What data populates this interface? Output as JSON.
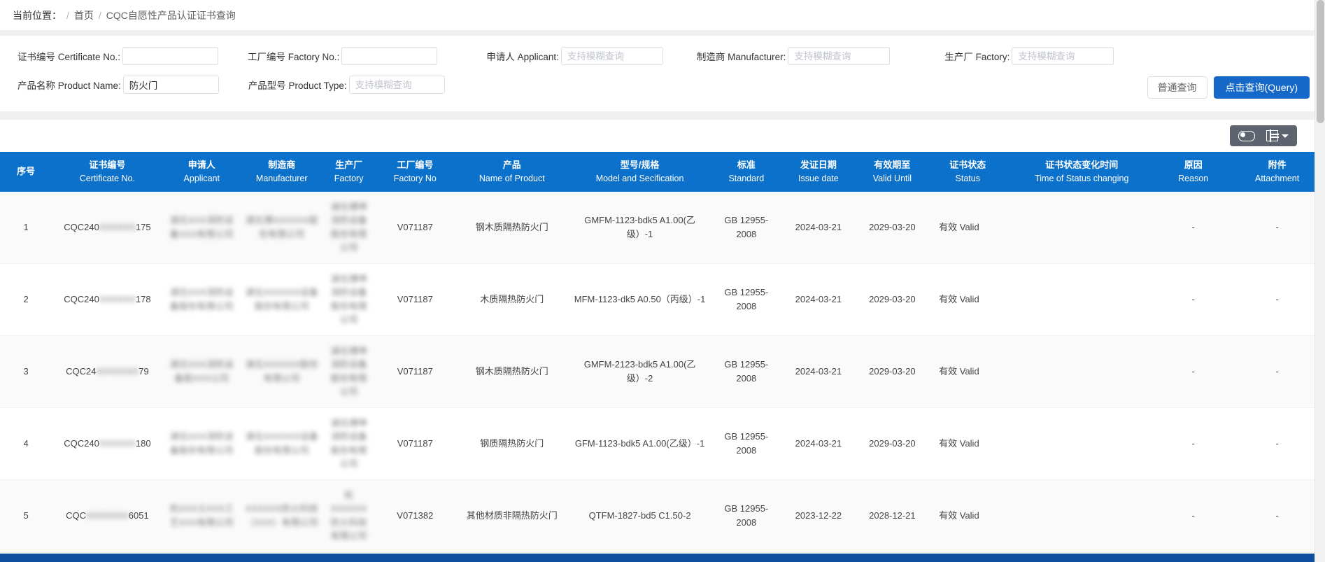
{
  "breadcrumb": {
    "label": "当前位置：",
    "sep": "/",
    "home": "首页",
    "current": "CQC自愿性产品认证证书查询"
  },
  "search": {
    "fields": [
      {
        "label": "证书编号 Certificate No.:",
        "value": "",
        "placeholder": ""
      },
      {
        "label": "工厂编号 Factory No.:",
        "value": "",
        "placeholder": ""
      },
      {
        "label": "申请人 Applicant:",
        "value": "",
        "placeholder": "支持模糊查询"
      },
      {
        "label": "制造商 Manufacturer:",
        "value": "",
        "placeholder": "支持模糊查询"
      },
      {
        "label": "生产厂 Factory:",
        "value": "",
        "placeholder": "支持模糊查询"
      },
      {
        "label": "产品名称 Product Name:",
        "value": "防火门",
        "placeholder": ""
      },
      {
        "label": "产品型号 Product Type:",
        "value": "",
        "placeholder": "支持模糊查询"
      }
    ],
    "normal_query_button": "普通查询",
    "query_button": "点击查询(Query)"
  },
  "toolbar": {
    "toggle_icon": "toggle-switch-icon",
    "columns_icon": "table-columns-icon",
    "caret_icon": "chevron-down-icon"
  },
  "table": {
    "columns": [
      {
        "cn": "序号",
        "en": ""
      },
      {
        "cn": "证书编号",
        "en": "Certificate No."
      },
      {
        "cn": "申请人",
        "en": "Applicant"
      },
      {
        "cn": "制造商",
        "en": "Manufacturer"
      },
      {
        "cn": "生产厂",
        "en": "Factory"
      },
      {
        "cn": "工厂编号",
        "en": "Factory No"
      },
      {
        "cn": "产品",
        "en": "Name of Product"
      },
      {
        "cn": "型号/规格",
        "en": "Model and Secification"
      },
      {
        "cn": "标准",
        "en": "Standard"
      },
      {
        "cn": "发证日期",
        "en": "Issue date"
      },
      {
        "cn": "有效期至",
        "en": "Valid Until"
      },
      {
        "cn": "证书状态",
        "en": "Status"
      },
      {
        "cn": "证书状态变化时间",
        "en": "Time of Status changing"
      },
      {
        "cn": "原因",
        "en": "Reason"
      },
      {
        "cn": "附件",
        "en": "Attachment"
      }
    ],
    "rows": [
      {
        "index": "1",
        "certificate_no_prefix": "CQC240",
        "certificate_no_redacted": "XXXXXX",
        "certificate_no_suffix": "175",
        "applicant": "湖北XXX消防设备XXX有限公司",
        "manufacturer": "湖北博XXXXXX股份有限公司",
        "factory": "湖北博坤消防设备股份有限公司",
        "factory_no": "V071187",
        "product": "钢木质隔热防火门",
        "model": "GMFM-1123-bdk5 A1.00(乙级）-1",
        "standard": "GB 12955-2008",
        "issue_date": "2024-03-21",
        "valid_until": "2029-03-20",
        "status": "有效 Valid",
        "status_change_time": "",
        "reason": "-",
        "attachment": "-"
      },
      {
        "index": "2",
        "certificate_no_prefix": "CQC240",
        "certificate_no_redacted": "XXXXXX",
        "certificate_no_suffix": "178",
        "applicant": "湖北XXX消防设备股份有限公司",
        "manufacturer": "湖北XXXXXX设备股份有限公司",
        "factory": "湖北博坤消防设备股份有限公司",
        "factory_no": "V071187",
        "product": "木质隔热防火门",
        "model": "MFM-1123-dk5 A0.50（丙级）-1",
        "standard": "GB 12955-2008",
        "issue_date": "2024-03-21",
        "valid_until": "2029-03-20",
        "status": "有效 Valid",
        "status_change_time": "",
        "reason": "-",
        "attachment": "-"
      },
      {
        "index": "3",
        "certificate_no_prefix": "CQC24",
        "certificate_no_redacted": "XXXXXXX",
        "certificate_no_suffix": "79",
        "applicant": "湖北XXX消防设备股XXX公司",
        "manufacturer": "湖北XXXXXX股份有限公司",
        "factory": "湖北博坤消防设备股份有限公司",
        "factory_no": "V071187",
        "product": "钢木质隔热防火门",
        "model": "GMFM-2123-bdk5 A1.00(乙级）-2",
        "standard": "GB 12955-2008",
        "issue_date": "2024-03-21",
        "valid_until": "2029-03-20",
        "status": "有效 Valid",
        "status_change_time": "",
        "reason": "-",
        "attachment": "-"
      },
      {
        "index": "4",
        "certificate_no_prefix": "CQC240",
        "certificate_no_redacted": "XXXXXX",
        "certificate_no_suffix": "180",
        "applicant": "湖北XXX消防设备股份有限公司",
        "manufacturer": "湖北XXXXXX设备股份有限公司",
        "factory": "湖北博坤消防设备股份有限公司",
        "factory_no": "V071187",
        "product": "钢质隔热防火门",
        "model": "GFM-1123-bdk5 A1.00(乙级）-1",
        "standard": "GB 12955-2008",
        "issue_date": "2024-03-21",
        "valid_until": "2029-03-20",
        "status": "有效 Valid",
        "status_change_time": "",
        "reason": "-",
        "attachment": "-"
      },
      {
        "index": "5",
        "certificate_no_prefix": "CQC",
        "certificate_no_redacted": "XXXXXXX",
        "certificate_no_suffix": "6051",
        "applicant": "杭XXX义XXX工艺XXX有限公司",
        "manufacturer": "XXXXXX防火科技（XXX）有限公司",
        "factory": "杭XXXXXX防火科技有限公司",
        "factory_no": "V071382",
        "product": "其他材质非隔热防火门",
        "model": "QTFM-1827-bd5 C1.50-2",
        "standard": "GB 12955-2008",
        "issue_date": "2023-12-22",
        "valid_until": "2028-12-21",
        "status": "有效 Valid",
        "status_change_time": "",
        "reason": "-",
        "attachment": "-"
      }
    ]
  },
  "colors": {
    "header_blue": "#0c71ca",
    "primary_blue": "#1668c8",
    "footer_blue": "#0b4f9e",
    "toolbar_gray": "#5d6470"
  }
}
